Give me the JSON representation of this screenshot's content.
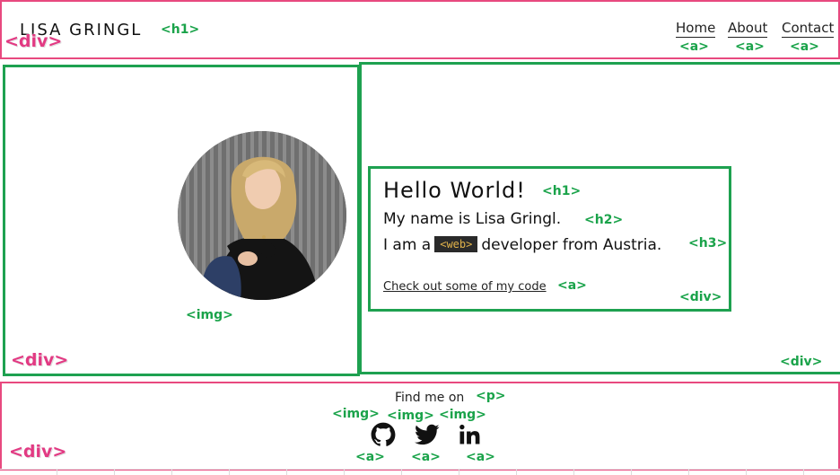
{
  "header": {
    "site_title": "LISA GRINGL",
    "nav": [
      {
        "label": "Home"
      },
      {
        "label": "About"
      },
      {
        "label": "Contact"
      }
    ]
  },
  "intro": {
    "greeting": "Hello World!",
    "name_line": "My name is Lisa Gringl.",
    "role_prefix": "I am a",
    "role_badge": "<web>",
    "role_suffix": "developer from Austria.",
    "code_link": "Check out some of my code"
  },
  "footer": {
    "find_me": "Find me on",
    "socials": [
      {
        "icon": "github-icon"
      },
      {
        "icon": "twitter-icon"
      },
      {
        "icon": "linkedin-icon"
      }
    ]
  },
  "annotations": {
    "div": "<div>",
    "h1": "<h1>",
    "h2": "<h2>",
    "h3": "<h3>",
    "a": "<a>",
    "img": "<img>",
    "p": "<p>"
  },
  "colors": {
    "element_outline_green": "#1ea150",
    "container_outline_pink": "#e8497f",
    "tag_green": "#1aa34a",
    "tag_pink": "#e23a83",
    "badge_bg": "#2a2a2a",
    "badge_text": "#e0b24a"
  }
}
